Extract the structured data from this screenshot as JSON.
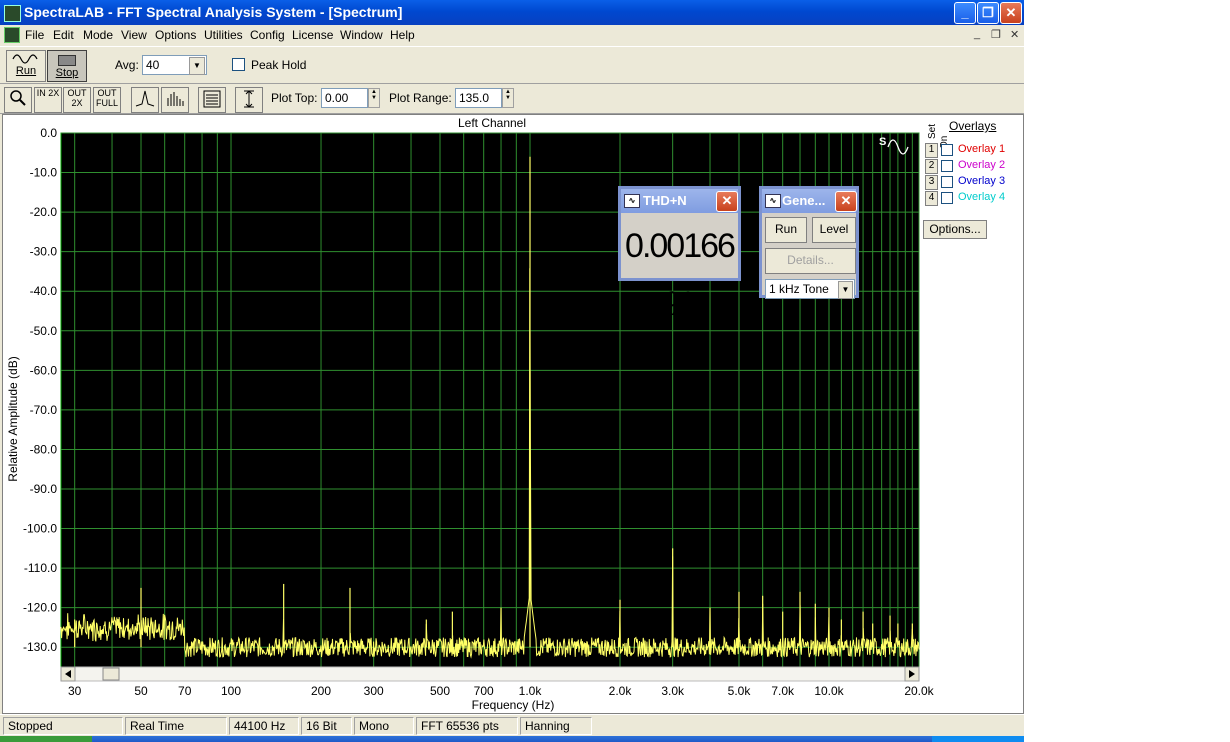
{
  "window": {
    "title": "SpectraLAB - FFT Spectral Analysis System - [Spectrum]",
    "minimize": "_",
    "restore": "❐",
    "close": "✕"
  },
  "menu": [
    "File",
    "Edit",
    "Mode",
    "View",
    "Options",
    "Utilities",
    "Config",
    "License",
    "Window",
    "Help"
  ],
  "mdi_controls": {
    "minimize": "_",
    "restore": "❐",
    "close": "✕"
  },
  "toolbar": {
    "run_label": "Run",
    "stop_label": "Stop",
    "avg_label": "Avg:",
    "avg_value": "40",
    "peak_hold_label": "Peak Hold",
    "zoom_in_label": "IN 2X",
    "zoom_out_label": "OUT 2X",
    "zoom_full_label": "OUT FULL",
    "plot_top_label": "Plot Top:",
    "plot_top_value": "0.00",
    "plot_range_label": "Plot Range:",
    "plot_range_value": "135.0"
  },
  "plot": {
    "channel_title": "Left Channel",
    "colors": {
      "background": "#000000",
      "grid": "#2f8f2f",
      "trace": "#ffff66",
      "border": "#00aa00"
    }
  },
  "chart_data": {
    "type": "line",
    "title": "Left Channel",
    "xlabel": "Frequency (Hz)",
    "ylabel": "Relative Amplitude (dB)",
    "xscale": "log",
    "xlim": [
      27,
      20000
    ],
    "ylim": [
      -135,
      0
    ],
    "grid": true,
    "y_ticks": [
      "0.0",
      "-10.0",
      "-20.0",
      "-30.0",
      "-40.0",
      "-50.0",
      "-60.0",
      "-70.0",
      "-80.0",
      "-90.0",
      "-100.0",
      "-110.0",
      "-120.0",
      "-130.0"
    ],
    "y_tick_values": [
      0,
      -10,
      -20,
      -30,
      -40,
      -50,
      -60,
      -70,
      -80,
      -90,
      -100,
      -110,
      -120,
      -130
    ],
    "x_ticks": [
      {
        "v": 30,
        "label": "30"
      },
      {
        "v": 50,
        "label": "50"
      },
      {
        "v": 70,
        "label": "70"
      },
      {
        "v": 100,
        "label": "100"
      },
      {
        "v": 200,
        "label": "200"
      },
      {
        "v": 300,
        "label": "300"
      },
      {
        "v": 500,
        "label": "500"
      },
      {
        "v": 700,
        "label": "700"
      },
      {
        "v": 1000,
        "label": "1.0k"
      },
      {
        "v": 2000,
        "label": "2.0k"
      },
      {
        "v": 3000,
        "label": "3.0k"
      },
      {
        "v": 5000,
        "label": "5.0k"
      },
      {
        "v": 7000,
        "label": "7.0k"
      },
      {
        "v": 10000,
        "label": "10.0k"
      },
      {
        "v": 20000,
        "label": "20.0k"
      }
    ],
    "noise_floor_db": -130,
    "peaks": [
      {
        "f": 30,
        "db": -123
      },
      {
        "f": 50,
        "db": -115
      },
      {
        "f": 150,
        "db": -114
      },
      {
        "f": 250,
        "db": -115
      },
      {
        "f": 450,
        "db": -123
      },
      {
        "f": 550,
        "db": -121
      },
      {
        "f": 800,
        "db": -120
      },
      {
        "f": 1000,
        "db": -6
      },
      {
        "f": 2000,
        "db": -118
      },
      {
        "f": 3000,
        "db": -105
      },
      {
        "f": 4000,
        "db": -120
      },
      {
        "f": 5000,
        "db": -116
      },
      {
        "f": 6000,
        "db": -117
      },
      {
        "f": 7000,
        "db": -121
      },
      {
        "f": 8000,
        "db": -116
      },
      {
        "f": 9000,
        "db": -119
      },
      {
        "f": 10000,
        "db": -120
      },
      {
        "f": 11000,
        "db": -123
      },
      {
        "f": 13000,
        "db": -121
      },
      {
        "f": 14000,
        "db": -124
      },
      {
        "f": 16000,
        "db": -122
      },
      {
        "f": 17000,
        "db": -124
      },
      {
        "f": 19000,
        "db": -124
      }
    ]
  },
  "overlays": {
    "header": "Overlays",
    "set_label": "Set",
    "on_label": "On",
    "items": [
      {
        "num": "1",
        "label": "Overlay 1",
        "color": "#e00000"
      },
      {
        "num": "2",
        "label": "Overlay 2",
        "color": "#cc00cc"
      },
      {
        "num": "3",
        "label": "Overlay 3",
        "color": "#0000cc"
      },
      {
        "num": "4",
        "label": "Overlay 4",
        "color": "#00cccc"
      }
    ],
    "options_label": "Options..."
  },
  "thd": {
    "title": "THD+N",
    "value": "0.00166 %"
  },
  "generator": {
    "title": "Gene...",
    "run_label": "Run",
    "level_label": "Level",
    "details_label": "Details...",
    "tone_value": "1 kHz Tone"
  },
  "status": [
    "Stopped",
    "Real Time",
    "44100 Hz",
    "16 Bit",
    "Mono",
    "FFT 65536 pts",
    "Hanning"
  ]
}
